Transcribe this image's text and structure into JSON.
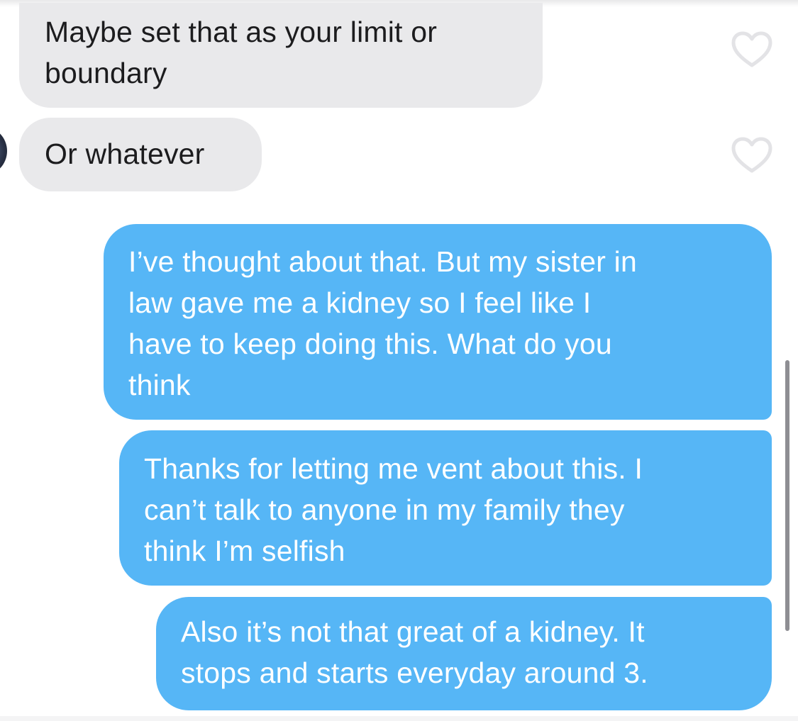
{
  "conversation": {
    "messages": [
      {
        "sender": "other",
        "text": "Maybe set that as your limit or\nboundary"
      },
      {
        "sender": "other",
        "text": "Or whatever"
      },
      {
        "sender": "me",
        "text": "I’ve thought about that. But my sister in\nlaw gave me a kidney so I feel like I\nhave to keep doing this. What do you\nthink"
      },
      {
        "sender": "me",
        "text": "Thanks for letting me vent about this. I\ncan’t talk to anyone in my family they\nthink I’m selfish"
      },
      {
        "sender": "me",
        "text": "Also it’s not that great of a kidney. It\nstops and starts everyday around 3."
      }
    ]
  },
  "icons": {
    "like": "heart-outline-icon",
    "avatar": "contact-avatar"
  },
  "colors": {
    "incoming_bubble": "#e9e9eb",
    "outgoing_bubble": "#56b6f6",
    "incoming_text": "#1c1c1e",
    "outgoing_text": "#ffffff",
    "heart_outline": "#e3e3e6"
  }
}
